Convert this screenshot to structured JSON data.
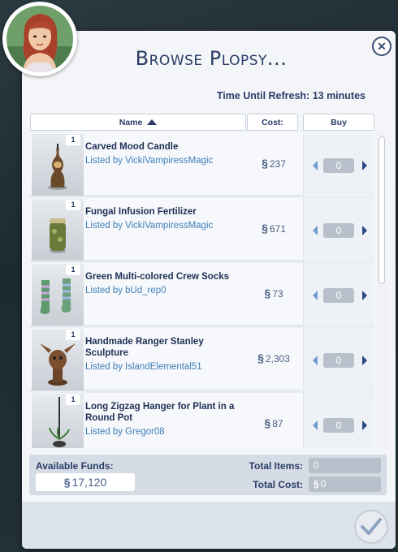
{
  "dialog": {
    "title": "Browse Plopsy...",
    "refresh_label": "Time Until Refresh: 13 minutes",
    "close_icon": "close-icon"
  },
  "table": {
    "headers": {
      "name": "Name",
      "cost": "Cost:",
      "buy": "Buy"
    },
    "sort": "ascending",
    "rows": [
      {
        "badge": "1",
        "name": "Carved Mood Candle",
        "seller_prefix": "Listed by",
        "seller": "VickiVampiressMagic",
        "currency": "§",
        "cost": "237",
        "qty": "0"
      },
      {
        "badge": "1",
        "name": "Fungal Infusion Fertilizer",
        "seller_prefix": "Listed by",
        "seller": "VickiVampiressMagic",
        "currency": "§",
        "cost": "671",
        "qty": "0"
      },
      {
        "badge": "1",
        "name": "Green Multi-colored Crew Socks",
        "seller_prefix": "Listed by",
        "seller": "bUd_rep0",
        "currency": "§",
        "cost": "73",
        "qty": "0"
      },
      {
        "badge": "1",
        "name": "Handmade Ranger Stanley Sculpture",
        "seller_prefix": "Listed by",
        "seller": "IslandElemental51",
        "currency": "§",
        "cost": "2,303",
        "qty": "0"
      },
      {
        "badge": "1",
        "name": "Long Zigzag Hanger for Plant in a Round Pot",
        "seller_prefix": "Listed by",
        "seller": "Gregor08",
        "currency": "§",
        "cost": "87",
        "qty": "0"
      }
    ]
  },
  "footer": {
    "funds_label": "Available Funds:",
    "funds_currency": "§",
    "funds_value": "17,120",
    "total_items_label": "Total Items:",
    "total_items_value": "0",
    "total_cost_label": "Total Cost:",
    "total_cost_currency": "§",
    "total_cost_value": "0"
  },
  "colors": {
    "title": "#2a3c66",
    "seller_link": "#3f7fb8",
    "panel": "#f3f5f8"
  }
}
